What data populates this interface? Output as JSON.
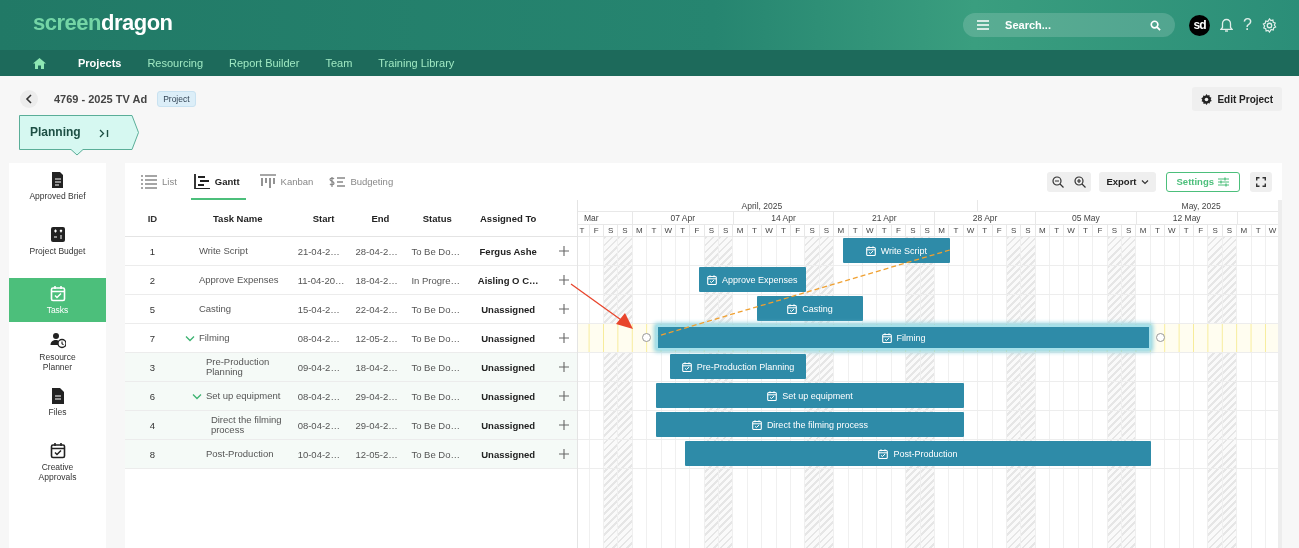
{
  "header": {
    "logo_light": "screen",
    "logo_bold": "dragon",
    "search": {
      "placeholder": "Search..."
    },
    "avatar": "sd",
    "help": "?"
  },
  "nav": [
    {
      "label": "Projects",
      "selected": true
    },
    {
      "label": "Resourcing",
      "selected": false
    },
    {
      "label": "Report Builder",
      "selected": false
    },
    {
      "label": "Team",
      "selected": false
    },
    {
      "label": "Training Library",
      "selected": false
    }
  ],
  "project": {
    "title": "4769 - 2025 TV Ad",
    "tag": "Project",
    "edit_button": "Edit Project"
  },
  "stage": {
    "label": "Planning"
  },
  "sidebar": {
    "items": [
      {
        "label": "Approved Brief",
        "kind": "brief",
        "selected": false
      },
      {
        "label": "Project Budget",
        "kind": "budget",
        "selected": false
      },
      {
        "label": "Tasks",
        "kind": "tasks",
        "selected": true
      },
      {
        "label": "Resource Planner",
        "kind": "planner",
        "selected": false
      },
      {
        "label": "Files",
        "kind": "files",
        "selected": false
      },
      {
        "label": "Creative Approvals",
        "kind": "approvals",
        "selected": false
      }
    ]
  },
  "views": {
    "tabs": [
      {
        "label": "List",
        "kind": "list",
        "selected": false
      },
      {
        "label": "Gantt",
        "kind": "gantt",
        "selected": true
      },
      {
        "label": "Kanban",
        "kind": "kanban",
        "selected": false
      },
      {
        "label": "Budgeting",
        "kind": "budgeting",
        "selected": false
      }
    ],
    "export_button": "Export",
    "settings_button": "Settings"
  },
  "table": {
    "columns": [
      "ID",
      "Task Name",
      "Start",
      "End",
      "Status",
      "Assigned To"
    ],
    "rows": [
      {
        "number": "1",
        "name": "Write Script",
        "start": "21-04-2…",
        "end": "28-04-2…",
        "status": "To Be Do…",
        "assignee": "Fergus Ashe"
      },
      {
        "number": "2",
        "name": "Approve Expenses",
        "start": "11-04-20…",
        "end": "18-04-2…",
        "status": "In Progre…",
        "assignee": "Aisling O C…"
      },
      {
        "number": "5",
        "name": "Casting",
        "start": "15-04-2…",
        "end": "22-04-2…",
        "status": "To Be Do…",
        "assignee": "Unassigned"
      },
      {
        "number": "7",
        "name": "Filming",
        "start": "08-04-2…",
        "end": "12-05-2…",
        "status": "To Be Do…",
        "assignee": "Unassigned",
        "expanded": true,
        "children": [
          {
            "number": "3",
            "name": "Pre-Production Planning",
            "start": "09-04-2…",
            "end": "18-04-2…",
            "status": "To Be Do…",
            "assignee": "Unassigned"
          },
          {
            "number": "6",
            "name": "Set up equipment",
            "start": "08-04-2…",
            "end": "29-04-2…",
            "status": "To Be Do…",
            "assignee": "Unassigned",
            "expanded": true,
            "children": [
              {
                "number": "4",
                "name": "Direct the filming process",
                "start": "08-04-2…",
                "end": "29-04-2…",
                "status": "To Be Do…",
                "assignee": "Unassigned"
              }
            ]
          },
          {
            "number": "8",
            "name": "Post-Production",
            "start": "10-04-2…",
            "end": "12-05-2…",
            "status": "To Be Do…",
            "assignee": "Unassigned"
          }
        ]
      }
    ]
  },
  "gantt": {
    "months": [
      "April, 2025",
      "May, 2025"
    ],
    "weeks": [
      "Mar",
      "07 Apr",
      "14 Apr",
      "21 Apr",
      "28 Apr",
      "05 May",
      "12 May"
    ],
    "days": [
      {
        "letter": "T",
        "weekend": false
      },
      {
        "letter": "F",
        "weekend": false
      },
      {
        "letter": "S",
        "weekend": true
      },
      {
        "letter": "S",
        "weekend": true
      },
      {
        "letter": "M",
        "weekend": false
      },
      {
        "letter": "T",
        "weekend": false
      },
      {
        "letter": "W",
        "weekend": false
      },
      {
        "letter": "T",
        "weekend": false
      },
      {
        "letter": "F",
        "weekend": false
      },
      {
        "letter": "S",
        "weekend": true
      },
      {
        "letter": "S",
        "weekend": true
      },
      {
        "letter": "M",
        "weekend": false
      },
      {
        "letter": "T",
        "weekend": false
      },
      {
        "letter": "W",
        "weekend": false
      },
      {
        "letter": "T",
        "weekend": false
      },
      {
        "letter": "F",
        "weekend": false
      },
      {
        "letter": "S",
        "weekend": true
      },
      {
        "letter": "S",
        "weekend": true
      },
      {
        "letter": "M",
        "weekend": false
      },
      {
        "letter": "T",
        "weekend": false
      },
      {
        "letter": "W",
        "weekend": false
      },
      {
        "letter": "T",
        "weekend": false
      },
      {
        "letter": "F",
        "weekend": false
      },
      {
        "letter": "S",
        "weekend": true
      },
      {
        "letter": "S",
        "weekend": true
      },
      {
        "letter": "M",
        "weekend": false
      },
      {
        "letter": "T",
        "weekend": false
      },
      {
        "letter": "W",
        "weekend": false
      },
      {
        "letter": "T",
        "weekend": false
      },
      {
        "letter": "F",
        "weekend": false
      },
      {
        "letter": "S",
        "weekend": true
      },
      {
        "letter": "S",
        "weekend": true
      },
      {
        "letter": "M",
        "weekend": false
      },
      {
        "letter": "T",
        "weekend": false
      },
      {
        "letter": "W",
        "weekend": false
      },
      {
        "letter": "T",
        "weekend": false
      },
      {
        "letter": "F",
        "weekend": false
      },
      {
        "letter": "S",
        "weekend": true
      },
      {
        "letter": "S",
        "weekend": true
      },
      {
        "letter": "M",
        "weekend": false
      },
      {
        "letter": "T",
        "weekend": false
      },
      {
        "letter": "W",
        "weekend": false
      },
      {
        "letter": "T",
        "weekend": false
      },
      {
        "letter": "F",
        "weekend": false
      },
      {
        "letter": "S",
        "weekend": true
      },
      {
        "letter": "S",
        "weekend": true
      },
      {
        "letter": "M",
        "weekend": false
      },
      {
        "letter": "T",
        "weekend": false
      },
      {
        "letter": "W",
        "weekend": false
      }
    ],
    "bars": [
      {
        "label": "Write Script",
        "selected": false,
        "dependency_from": true
      },
      {
        "label": "Approve Expenses",
        "selected": false
      },
      {
        "label": "Casting",
        "selected": false
      },
      {
        "label": "Filming",
        "selected": true,
        "dependency_to": true
      },
      {
        "label": "Pre-Production Planning",
        "selected": false
      },
      {
        "label": "Set up equipment",
        "selected": false
      },
      {
        "label": "Direct the filming process",
        "selected": false
      },
      {
        "label": "Post-Production",
        "selected": false
      }
    ]
  },
  "annotations": [
    {
      "kind": "arrow"
    }
  ]
}
